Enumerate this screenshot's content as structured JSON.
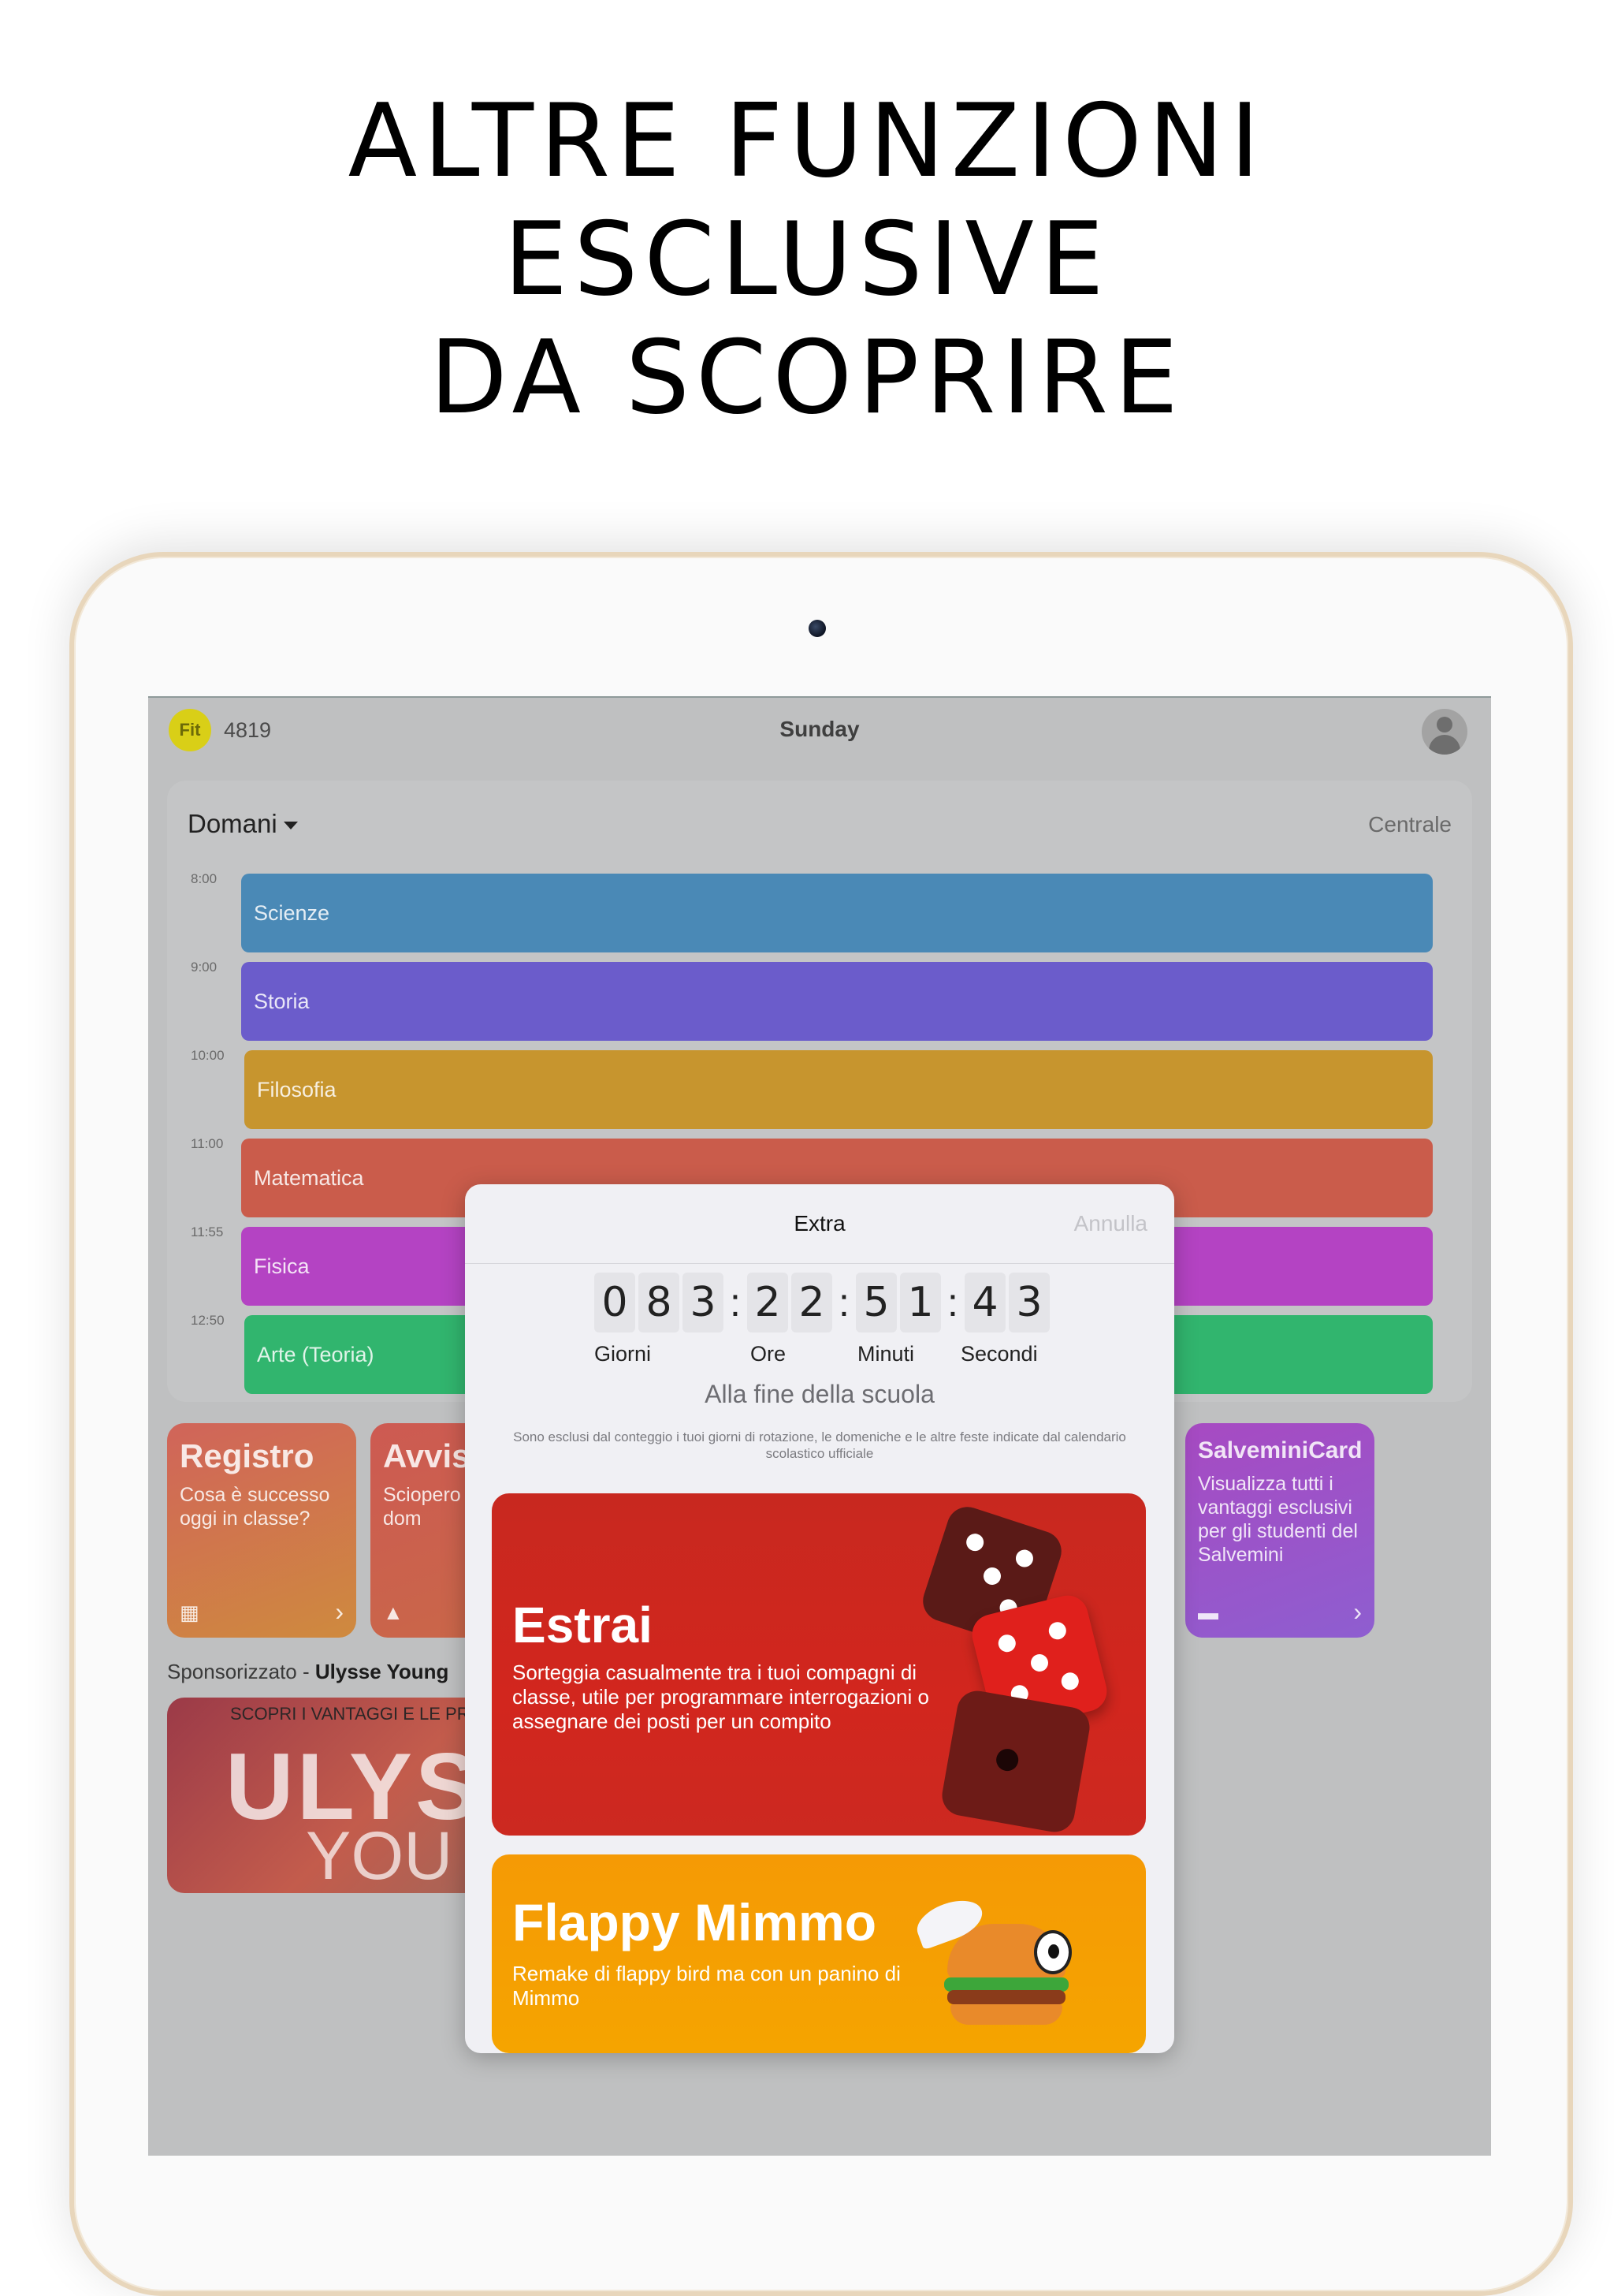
{
  "headline": {
    "line1": "ALTRE FUNZIONI",
    "line2": "ESCLUSIVE",
    "line3": "DA SCOPRIRE"
  },
  "topbar": {
    "logo_text": "Fit",
    "points": "4819",
    "day": "Sunday"
  },
  "schedule": {
    "title": "Domani",
    "branch": "Centrale",
    "lessons": [
      {
        "time": "8:00",
        "subject": "Scienze",
        "color": "#4a89b6"
      },
      {
        "time": "9:00",
        "subject": "Storia",
        "color": "#6b5ccb"
      },
      {
        "time": "10:00",
        "subject": "Filosofia",
        "color": "#c7952e"
      },
      {
        "time": "11:00",
        "subject": "Matematica",
        "color": "#ca5c4b"
      },
      {
        "time": "11:55",
        "subject": "Fisica",
        "color": "#b443c3"
      },
      {
        "time": "12:50",
        "subject": "Arte (Teoria)",
        "color": "#31b56e"
      }
    ]
  },
  "tiles": [
    {
      "title": "Registro",
      "desc": "Cosa è successo oggi in classe?",
      "icon": "calendar-icon"
    },
    {
      "title": "Avvis",
      "desc": "Sciopero treni dom",
      "icon": "warning-icon"
    },
    {
      "title": "SalveminiCard",
      "desc": "Visualizza tutti i vantaggi esclusivi per gli studenti del Salvemini",
      "icon": "card-icon"
    }
  ],
  "sponsor": {
    "label": "Sponsorizzato -",
    "name": "Ulysse Young",
    "banner_top": "SCOPRI I VANTAGGI E LE PR",
    "banner_big": "ULYS",
    "banner_sub": "YOU"
  },
  "modal": {
    "title": "Extra",
    "cancel": "Annulla",
    "countdown": {
      "days": [
        "0",
        "8",
        "3"
      ],
      "hours": [
        "2",
        "2"
      ],
      "minutes": [
        "5",
        "1"
      ],
      "seconds": [
        "4",
        "3"
      ],
      "labels": {
        "days": "Giorni",
        "hours": "Ore",
        "minutes": "Minuti",
        "seconds": "Secondi"
      }
    },
    "caption": "Alla fine della scuola",
    "note": "Sono esclusi dal conteggio i tuoi giorni di rotazione, le domeniche e le altre feste indicate dal calendario scolastico ufficiale",
    "cards": {
      "estrai": {
        "title": "Estrai",
        "desc": "Sorteggia casualmente tra i tuoi compagni di classe, utile per programmare interrogazioni o assegnare dei posti per un compito"
      },
      "flappy": {
        "title": "Flappy Mimmo",
        "desc": "Remake di flappy bird ma con un panino di Mimmo"
      }
    }
  }
}
